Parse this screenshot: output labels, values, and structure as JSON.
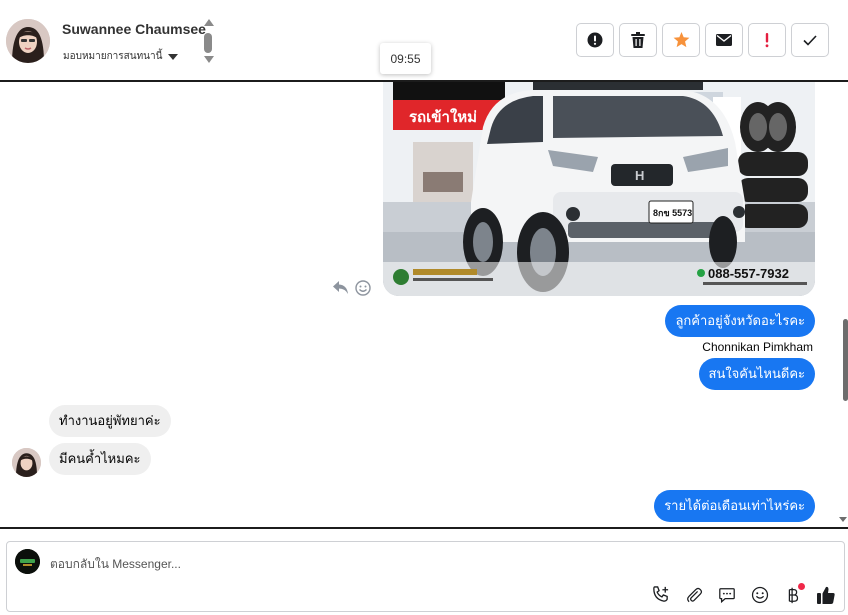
{
  "header": {
    "contact_name": "Suwannee Chaumsee",
    "assign_label": "มอบหมายการสนทนานี้",
    "tooltip_time": "09:55",
    "tools": [
      {
        "icon": "alert-circle-icon"
      },
      {
        "icon": "trash-icon"
      },
      {
        "icon": "star-icon",
        "color": "#f7923b"
      },
      {
        "icon": "mail-icon"
      },
      {
        "icon": "exclamation-icon",
        "color": "#e41e3f"
      },
      {
        "icon": "check-icon"
      }
    ]
  },
  "photo": {
    "banner_text": "รถเข้าใหม่",
    "plate_text": "8กข 5573",
    "phone": "088-557-7932"
  },
  "messages": [
    {
      "direction": "out",
      "text": "ลูกค้าอยู่จังหวัดอะไรคะ"
    },
    {
      "sender": "Chonnikan Pimkham"
    },
    {
      "direction": "out",
      "text": "สนใจคันไหนดีคะ"
    },
    {
      "direction": "in",
      "text": "ทำงานอยู่พัทยาค่ะ"
    },
    {
      "direction": "in",
      "text": "มีคนค้ำไหมคะ"
    },
    {
      "direction": "out",
      "text": "รายได้ต่อเดือนเท่าไหร่คะ"
    }
  ],
  "composer": {
    "placeholder": "ตอบกลับใน Messenger...",
    "tools": [
      "phone-add-icon",
      "paperclip-icon",
      "saved-reply-icon",
      "emoji-icon",
      "baht-payment-icon",
      "thumbs-up-icon"
    ]
  },
  "colors": {
    "accent": "#1877f2",
    "incoming_bubble": "#efefef",
    "alert_red": "#e41e3f",
    "star_orange": "#f7923b"
  }
}
